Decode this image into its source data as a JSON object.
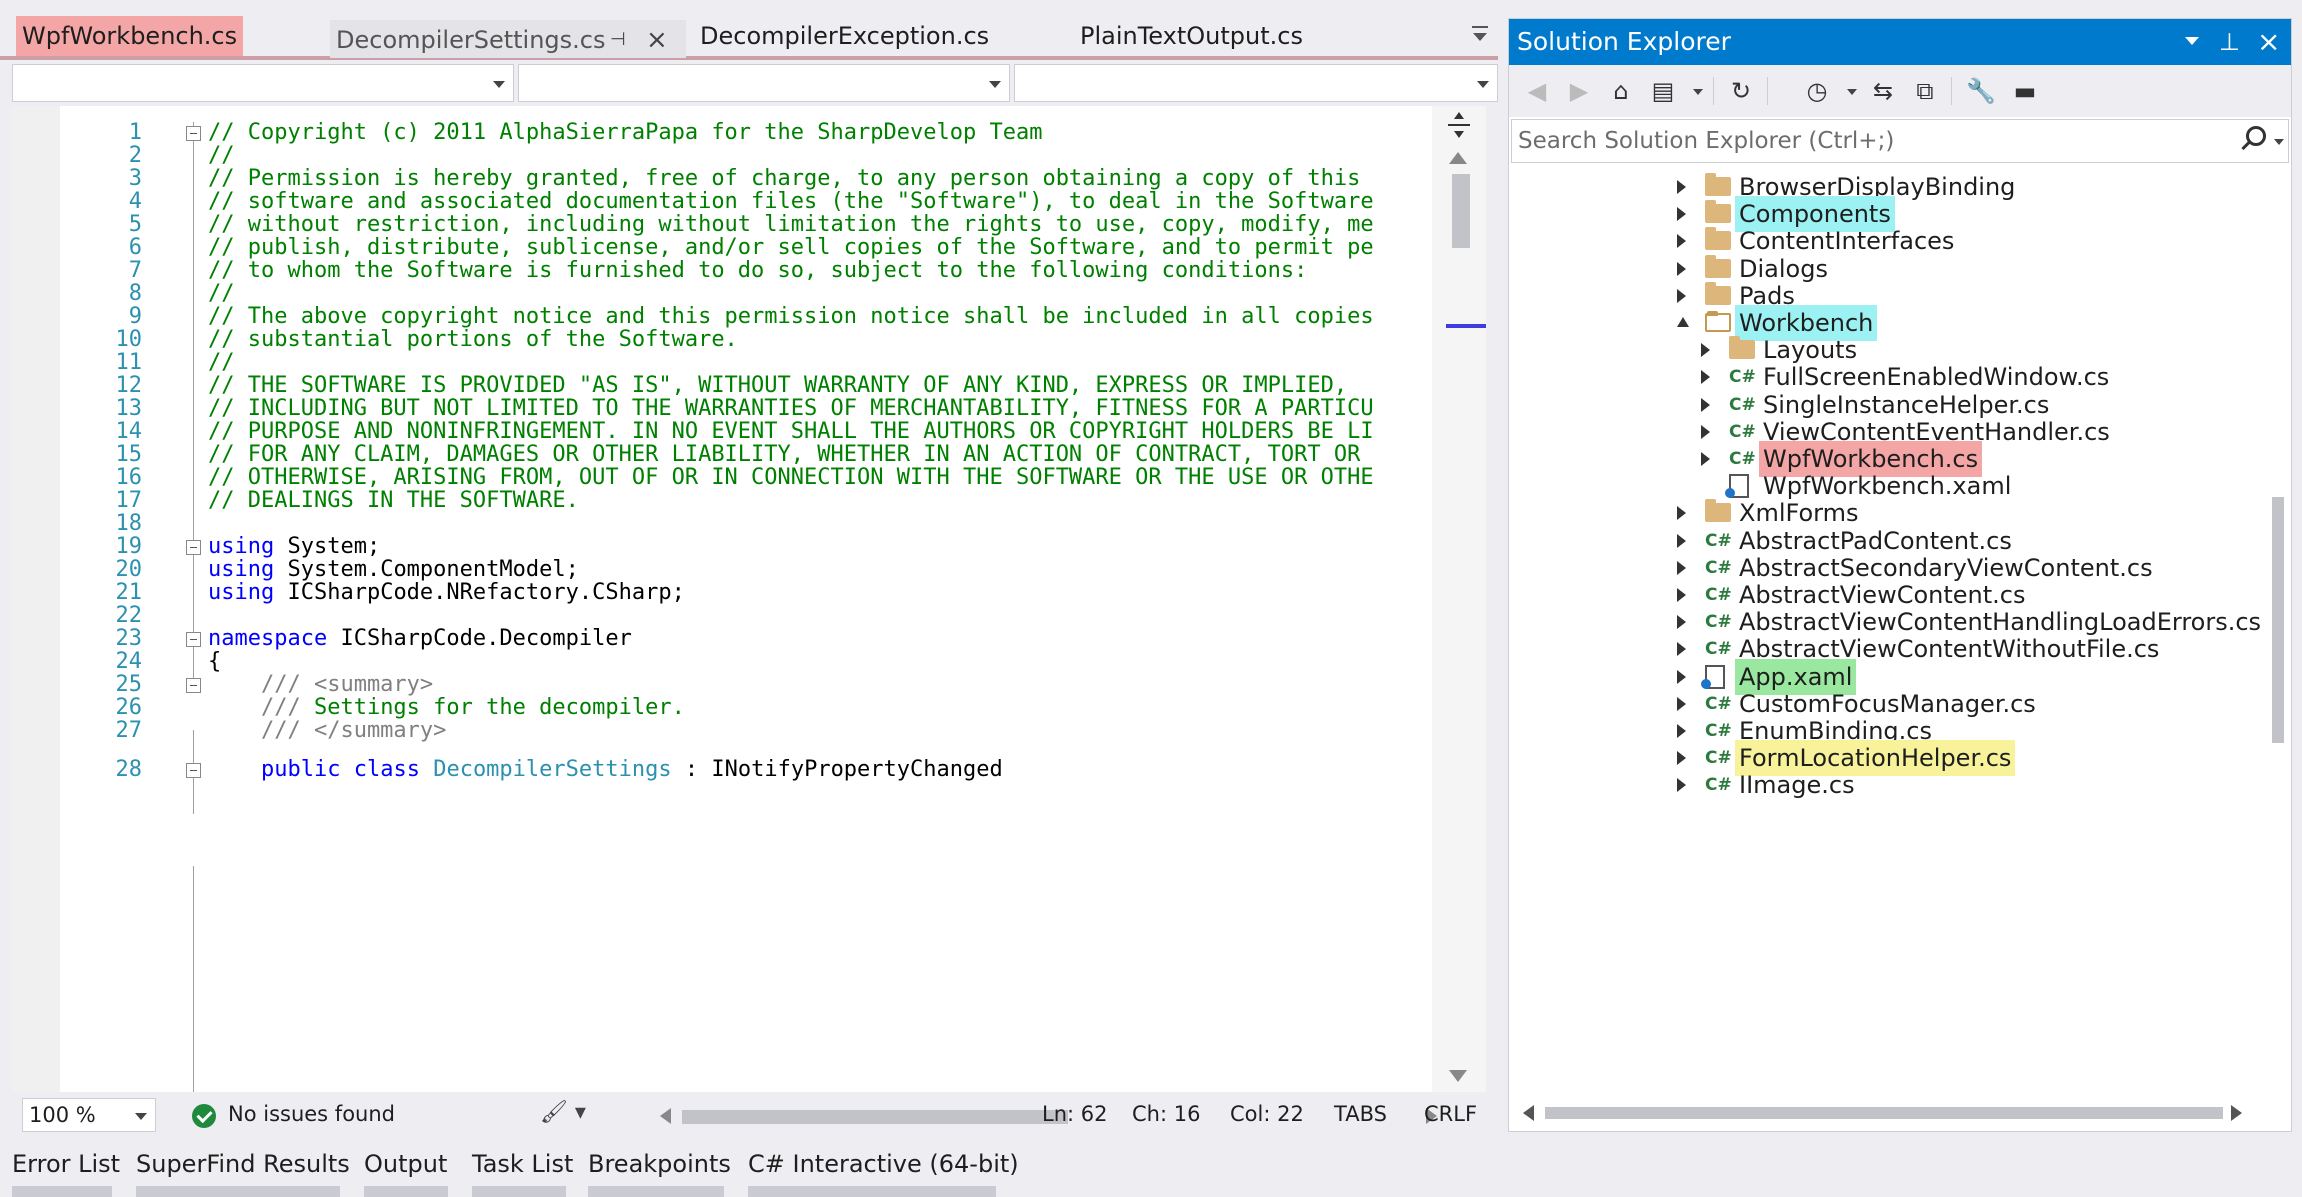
{
  "tabs": [
    {
      "label": "WpfWorkbench.cs",
      "active": true
    },
    {
      "label": "DecompilerSettings.cs"
    },
    {
      "label": "DecompilerException.cs"
    },
    {
      "label": "PlainTextOutput.cs"
    }
  ],
  "code_lines": [
    {
      "n": "1",
      "fold": true,
      "parts": [
        [
          "cmt",
          "// Copyright (c) 2011 AlphaSierraPapa for the SharpDevelop Team"
        ]
      ]
    },
    {
      "n": "2",
      "parts": [
        [
          "cmt",
          "//"
        ]
      ]
    },
    {
      "n": "3",
      "parts": [
        [
          "cmt",
          "// Permission is hereby granted, free of charge, to any person obtaining a copy of this"
        ]
      ]
    },
    {
      "n": "4",
      "parts": [
        [
          "cmt",
          "// software and associated documentation files (the \"Software\"), to deal in the Software"
        ]
      ]
    },
    {
      "n": "5",
      "parts": [
        [
          "cmt",
          "// without restriction, including without limitation the rights to use, copy, modify, me"
        ]
      ]
    },
    {
      "n": "6",
      "parts": [
        [
          "cmt",
          "// publish, distribute, sublicense, and/or sell copies of the Software, and to permit pe"
        ]
      ]
    },
    {
      "n": "7",
      "parts": [
        [
          "cmt",
          "// to whom the Software is furnished to do so, subject to the following conditions:"
        ]
      ]
    },
    {
      "n": "8",
      "parts": [
        [
          "cmt",
          "//"
        ]
      ]
    },
    {
      "n": "9",
      "parts": [
        [
          "cmt",
          "// The above copyright notice and this permission notice shall be included in all copies"
        ]
      ]
    },
    {
      "n": "10",
      "parts": [
        [
          "cmt",
          "// substantial portions of the Software."
        ]
      ]
    },
    {
      "n": "11",
      "parts": [
        [
          "cmt",
          "//"
        ]
      ]
    },
    {
      "n": "12",
      "parts": [
        [
          "cmt",
          "// THE SOFTWARE IS PROVIDED \"AS IS\", WITHOUT WARRANTY OF ANY KIND, EXPRESS OR IMPLIED, "
        ]
      ]
    },
    {
      "n": "13",
      "parts": [
        [
          "cmt",
          "// INCLUDING BUT NOT LIMITED TO THE WARRANTIES OF MERCHANTABILITY, FITNESS FOR A PARTICU"
        ]
      ]
    },
    {
      "n": "14",
      "parts": [
        [
          "cmt",
          "// PURPOSE AND NONINFRINGEMENT. IN NO EVENT SHALL THE AUTHORS OR COPYRIGHT HOLDERS BE LI"
        ]
      ]
    },
    {
      "n": "15",
      "parts": [
        [
          "cmt",
          "// FOR ANY CLAIM, DAMAGES OR OTHER LIABILITY, WHETHER IN AN ACTION OF CONTRACT, TORT OR "
        ]
      ]
    },
    {
      "n": "16",
      "parts": [
        [
          "cmt",
          "// OTHERWISE, ARISING FROM, OUT OF OR IN CONNECTION WITH THE SOFTWARE OR THE USE OR OTHE"
        ]
      ]
    },
    {
      "n": "17",
      "parts": [
        [
          "cmt",
          "// DEALINGS IN THE SOFTWARE."
        ]
      ]
    },
    {
      "n": "18",
      "parts": []
    },
    {
      "n": "19",
      "fold": true,
      "parts": [
        [
          "kw",
          "using"
        ],
        [
          "pln",
          " System;"
        ]
      ]
    },
    {
      "n": "20",
      "parts": [
        [
          "kw",
          "using"
        ],
        [
          "pln",
          " System.ComponentModel;"
        ]
      ]
    },
    {
      "n": "21",
      "parts": [
        [
          "kw",
          "using"
        ],
        [
          "pln",
          " ICSharpCode.NRefactory.CSharp;"
        ]
      ]
    },
    {
      "n": "22",
      "parts": []
    },
    {
      "n": "23",
      "fold": true,
      "parts": [
        [
          "kw",
          "namespace"
        ],
        [
          "pln",
          " ICSharpCode.Decompiler"
        ]
      ]
    },
    {
      "n": "24",
      "parts": [
        [
          "pln",
          "{"
        ]
      ]
    },
    {
      "n": "25",
      "fold": true,
      "parts": [
        [
          "xml",
          "    /// <summary>"
        ]
      ]
    },
    {
      "n": "26",
      "parts": [
        [
          "xml",
          "    ///"
        ],
        [
          "cmt",
          " Settings for the decompiler."
        ]
      ]
    },
    {
      "n": "27",
      "parts": [
        [
          "xml",
          "    /// </summary>"
        ]
      ]
    },
    {
      "n": "28",
      "fold": true,
      "parts": [
        [
          "pln",
          "    "
        ],
        [
          "kw",
          "public"
        ],
        [
          "pln",
          " "
        ],
        [
          "kw",
          "class"
        ],
        [
          "pln",
          " "
        ],
        [
          "typ",
          "DecompilerSettings"
        ],
        [
          "pln",
          " : INotifyPropertyChanged"
        ]
      ]
    }
  ],
  "status": {
    "zoom": "100 %",
    "issues": "No issues found",
    "ln": "Ln: 62",
    "ch": "Ch: 16",
    "col": "Col: 22",
    "tabs": "TABS",
    "eol": "CRLF"
  },
  "bottom_tabs": [
    "Error List",
    "SuperFind Results",
    "Output",
    "Task List",
    "Breakpoints",
    "C# Interactive (64-bit)"
  ],
  "solution_explorer": {
    "title": "Solution Explorer",
    "search_placeholder": "Search Solution Explorer (Ctrl+;)",
    "items": [
      {
        "label": "BrowserDisplayBinding",
        "icon": "folder-icon",
        "level": 0,
        "expander": "collapsed"
      },
      {
        "label": "Components",
        "icon": "folder-icon",
        "level": 0,
        "expander": "collapsed",
        "highlight": "cyan"
      },
      {
        "label": "ContentInterfaces",
        "icon": "folder-icon",
        "level": 0,
        "expander": "collapsed"
      },
      {
        "label": "Dialogs",
        "icon": "folder-icon",
        "level": 0,
        "expander": "collapsed"
      },
      {
        "label": "Pads",
        "icon": "folder-icon",
        "level": 0,
        "expander": "collapsed"
      },
      {
        "label": "Workbench",
        "icon": "open-folder-icon",
        "level": 0,
        "expander": "expanded",
        "highlight": "cyan"
      },
      {
        "label": "Layouts",
        "icon": "folder-icon",
        "level": 1,
        "expander": "collapsed"
      },
      {
        "label": "FullScreenEnabledWindow.cs",
        "icon": "csharp-file-icon",
        "level": 1,
        "expander": "collapsed"
      },
      {
        "label": "SingleInstanceHelper.cs",
        "icon": "csharp-file-icon",
        "level": 1,
        "expander": "collapsed"
      },
      {
        "label": "ViewContentEventHandler.cs",
        "icon": "csharp-file-icon",
        "level": 1,
        "expander": "collapsed"
      },
      {
        "label": "WpfWorkbench.cs",
        "icon": "csharp-file-icon",
        "level": 1,
        "expander": "collapsed",
        "highlight": "red"
      },
      {
        "label": "WpfWorkbench.xaml",
        "icon": "xaml-file-icon",
        "level": 1,
        "expander": "none"
      },
      {
        "label": "XmlForms",
        "icon": "folder-icon",
        "level": 0,
        "expander": "collapsed"
      },
      {
        "label": "AbstractPadContent.cs",
        "icon": "csharp-file-icon",
        "level": 0,
        "expander": "collapsed"
      },
      {
        "label": "AbstractSecondaryViewContent.cs",
        "icon": "csharp-file-icon",
        "level": 0,
        "expander": "collapsed"
      },
      {
        "label": "AbstractViewContent.cs",
        "icon": "csharp-file-icon",
        "level": 0,
        "expander": "collapsed"
      },
      {
        "label": "AbstractViewContentHandlingLoadErrors.cs",
        "icon": "csharp-file-icon",
        "level": 0,
        "expander": "collapsed"
      },
      {
        "label": "AbstractViewContentWithoutFile.cs",
        "icon": "csharp-file-icon",
        "level": 0,
        "expander": "collapsed"
      },
      {
        "label": "App.xaml",
        "icon": "xaml-file-icon",
        "level": 0,
        "expander": "collapsed",
        "highlight": "green"
      },
      {
        "label": "CustomFocusManager.cs",
        "icon": "csharp-file-icon",
        "level": 0,
        "expander": "collapsed"
      },
      {
        "label": "EnumBinding.cs",
        "icon": "csharp-file-icon",
        "level": 0,
        "expander": "collapsed"
      },
      {
        "label": "FormLocationHelper.cs",
        "icon": "csharp-file-icon",
        "level": 0,
        "expander": "collapsed",
        "highlight": "yellow"
      },
      {
        "label": "IImage.cs",
        "icon": "csharp-file-icon",
        "level": 0,
        "expander": "collapsed"
      }
    ],
    "csharp_glyph": "C#"
  },
  "colors": {
    "accent": "#007acc",
    "highlight_cyan": "#9cf2f2",
    "highlight_red": "#f4a6a6",
    "highlight_green": "#9ae8a0",
    "highlight_yellow": "#f8f29a"
  }
}
